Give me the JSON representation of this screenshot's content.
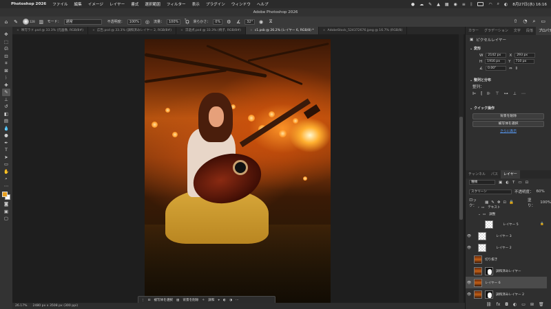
{
  "menubar": {
    "app_name": "Photoshop 2026",
    "items": [
      "ファイル",
      "編集",
      "イメージ",
      "レイヤー",
      "書式",
      "選択範囲",
      "フィルター",
      "表示",
      "プラグイン",
      "ウィンドウ",
      "ヘルプ"
    ],
    "datetime": "8月27日(水) 16:16"
  },
  "titlebar": {
    "title": "Adobe Photoshop 2026"
  },
  "options": {
    "mode_label": "モード：",
    "mode_value": "通常",
    "opacity_label": "不透明度：",
    "opacity_value": "100%",
    "flow_label": "流量：",
    "flow_value": "100%",
    "smooth_label": "滑らかさ：",
    "smooth_value": "0%",
    "angle_value": "32°",
    "brush_size": "128"
  },
  "tabs": [
    {
      "label": "映写ラド.psd @ 33.3% (元画像, RGB/8#)",
      "active": false
    },
    {
      "label": "広告.psd @ 33.3% (調和済みレイヤー 2, RGB/8#)",
      "active": false
    },
    {
      "label": "浮遊点.psd @ 33.3% (椅子, RGB/8#)",
      "active": false
    },
    {
      "label": "c1.psb @ 26.2% (レイヤー 6, RGB/8) *",
      "active": true
    },
    {
      "label": "AdobeStock_524372676.jpeg @ 16.7% (RGB/8)",
      "active": false
    }
  ],
  "contextbar": {
    "select_subject": "被写体を選択",
    "remove_bg": "背景を削除",
    "adjust": "調和"
  },
  "status": {
    "zoom": "26.17%",
    "dimensions": "2480 px x 3508 px (300 ppi)"
  },
  "right_panel": {
    "tabs": [
      "カラー",
      "グラデーション",
      "文字",
      "段落",
      "プロパティ"
    ],
    "pixel_layer": "ピクセルレイヤー",
    "transform": "変形",
    "w_label": "W",
    "w_value": "2142 px",
    "h_label": "H",
    "h_value": "1916 px",
    "x_label": "X",
    "x_value": "293 px",
    "y_label": "Y",
    "y_value": "710 px",
    "angle_value": "0.00°",
    "align_section": "整列と分布",
    "align_label": "整列：",
    "quick_actions": "クイック操作",
    "remove_bg_btn": "背景を削除",
    "select_subject_btn": "被写体を選択",
    "more_link": "さらに表示"
  },
  "layers_panel": {
    "tabs": [
      "チャンネル",
      "パス",
      "レイヤー"
    ],
    "filter_kind": "種類",
    "blend_mode": "スクリーン",
    "opacity_label": "不透明度：",
    "opacity_value": "60%",
    "lock_label": "ロック：",
    "fill_label": "塗り：",
    "fill_value": "100%",
    "layers": [
      {
        "name": "テキスト",
        "type": "group",
        "visible": false
      },
      {
        "name": "調整",
        "type": "group-open",
        "visible": false
      },
      {
        "name": "レイヤー 5",
        "type": "checker",
        "visible": false
      },
      {
        "name": "レイヤー 3",
        "type": "checker",
        "visible": true
      },
      {
        "name": "レイヤー 2",
        "type": "checker",
        "visible": true
      },
      {
        "name": "切り抜き",
        "type": "photo",
        "visible": false
      },
      {
        "name": "調和済みレイヤー",
        "type": "photo-mask",
        "visible": false
      },
      {
        "name": "レイヤー 6",
        "type": "photo",
        "visible": true,
        "selected": true
      },
      {
        "name": "調和済みレイヤー 2",
        "type": "photo-mask",
        "visible": true
      }
    ]
  },
  "colors": {
    "foreground": "#e8a020",
    "background": "#ffffff",
    "accent": "#5aa0ff"
  }
}
